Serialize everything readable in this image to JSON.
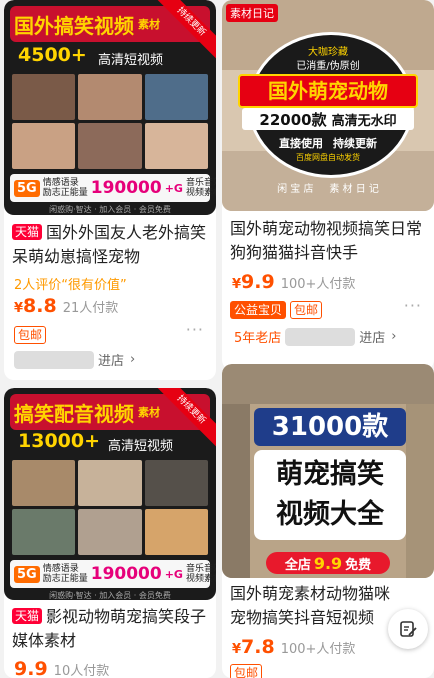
{
  "items": [
    {
      "poster": {
        "title": "国外搞笑视频",
        "title_suffix": "素材",
        "count": "4500+",
        "hd": "高清短视频",
        "ribbon": "持续更新",
        "strip_5g": "5G",
        "strip_left": "情感语录\n励志正能量",
        "strip_count": "190000",
        "strip_plus": "+G",
        "strip_right": "音乐音效\n视频素材",
        "footer": "闲惑购·智达 · 加入会员 · 会员免费"
      },
      "tag": "天猫",
      "title": "国外外国友人老外搞笑呆萌幼崽搞怪宠物",
      "eval": "2人评价“很有价值”",
      "yen": "¥",
      "price": "8.8",
      "paid": "21人付款",
      "badge": "包邮",
      "shop_enter": "进店"
    },
    {
      "poster": {
        "corner": "素材日记",
        "ribbon_top": "大咖珍藏",
        "sub1": "已消重/伪原创",
        "title": "国外萌宠动物",
        "count": "22000款",
        "hd": "高清无水印",
        "use": "直接使用",
        "update": "持续更新",
        "note": "百度网盘自动发货",
        "footer": "闲 宝 店     素 材 日 记"
      },
      "title": "国外萌宠动物视频搞笑日常狗狗猫猫抖音快手",
      "yen": "¥",
      "price": "9.9",
      "paid": "100+人付款",
      "badge_fill": "公益宝贝",
      "badge": "包邮",
      "shop_age": "5年老店",
      "shop_enter": "进店"
    },
    {
      "poster": {
        "title": "搞笑配音视频",
        "title_suffix": "素材",
        "count": "13000+",
        "hd": "高清短视频",
        "ribbon": "持续更新",
        "strip_5g": "5G",
        "strip_left": "情感语录\n励志正能量",
        "strip_count": "190000",
        "strip_plus": "+G",
        "strip_right": "音乐音效\n视频素材",
        "footer": "闲惑购·智达 · 加入会员 · 会员免费"
      },
      "tag": "天猫",
      "title": "影视动物萌宠搞笑段子媒体素材",
      "price": "9.9",
      "paid": "10人付款"
    },
    {
      "poster": {
        "count": "31000款",
        "line1": "萌宠搞笑",
        "line2": "视频大全",
        "promo": "全店",
        "promo_price": "9.9",
        "promo_suffix": "免费"
      },
      "title": "国外萌宠素材动物猫咪宠物搞笑抖音短视频",
      "yen": "¥",
      "price": "7.8",
      "paid": "100+人付款",
      "badge": "包邮"
    }
  ],
  "float_icon": "edit-icon",
  "colors": {
    "price": "#ff5000",
    "tmall": "#ff0036",
    "poster_red": "#c8102e",
    "poster_yellow": "#ffd400"
  }
}
